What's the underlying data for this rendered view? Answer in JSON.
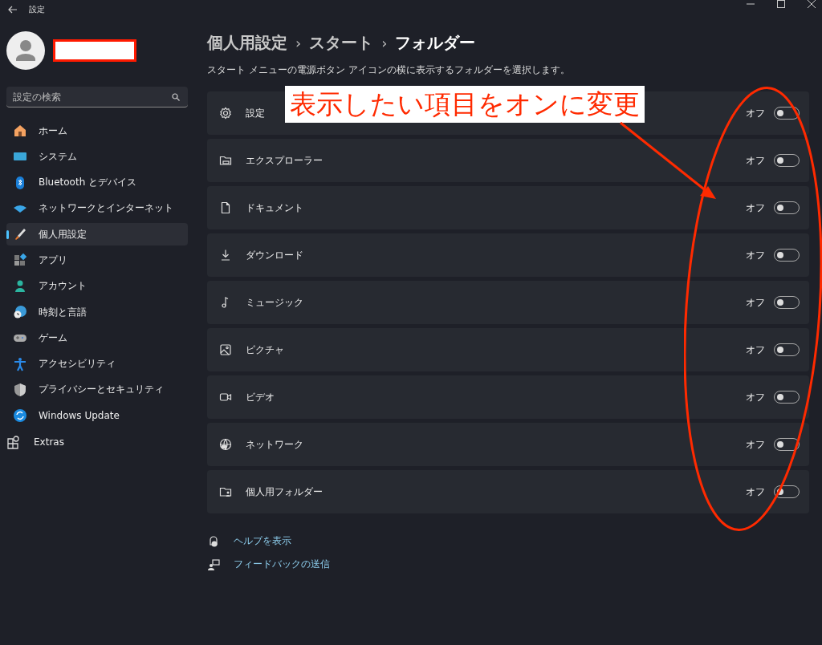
{
  "window": {
    "title": "設定"
  },
  "search": {
    "placeholder": "設定の検索"
  },
  "sidebar": {
    "items": [
      {
        "label": "ホーム",
        "selected": false
      },
      {
        "label": "システム",
        "selected": false
      },
      {
        "label": "Bluetooth とデバイス",
        "selected": false
      },
      {
        "label": "ネットワークとインターネット",
        "selected": false
      },
      {
        "label": "個人用設定",
        "selected": true
      },
      {
        "label": "アプリ",
        "selected": false
      },
      {
        "label": "アカウント",
        "selected": false
      },
      {
        "label": "時刻と言語",
        "selected": false
      },
      {
        "label": "ゲーム",
        "selected": false
      },
      {
        "label": "アクセシビリティ",
        "selected": false
      },
      {
        "label": "プライバシーとセキュリティ",
        "selected": false
      },
      {
        "label": "Windows Update",
        "selected": false
      },
      {
        "label": "Extras",
        "selected": false
      }
    ]
  },
  "breadcrumb": [
    "個人用設定",
    "スタート",
    "フォルダー"
  ],
  "breadcrumb_separator": "›",
  "description": "スタート メニューの電源ボタン アイコンの横に表示するフォルダーを選択します。",
  "folders": [
    {
      "label": "設定",
      "state_text": "オフ",
      "on": false
    },
    {
      "label": "エクスプローラー",
      "state_text": "オフ",
      "on": false
    },
    {
      "label": "ドキュメント",
      "state_text": "オフ",
      "on": false
    },
    {
      "label": "ダウンロード",
      "state_text": "オフ",
      "on": false
    },
    {
      "label": "ミュージック",
      "state_text": "オフ",
      "on": false
    },
    {
      "label": "ピクチャ",
      "state_text": "オフ",
      "on": false
    },
    {
      "label": "ビデオ",
      "state_text": "オフ",
      "on": false
    },
    {
      "label": "ネットワーク",
      "state_text": "オフ",
      "on": false
    },
    {
      "label": "個人用フォルダー",
      "state_text": "オフ",
      "on": false
    }
  ],
  "links": [
    "ヘルプを表示",
    "フィードバックの送信"
  ],
  "annotation": {
    "text": "表示したい項目をオンに変更"
  }
}
